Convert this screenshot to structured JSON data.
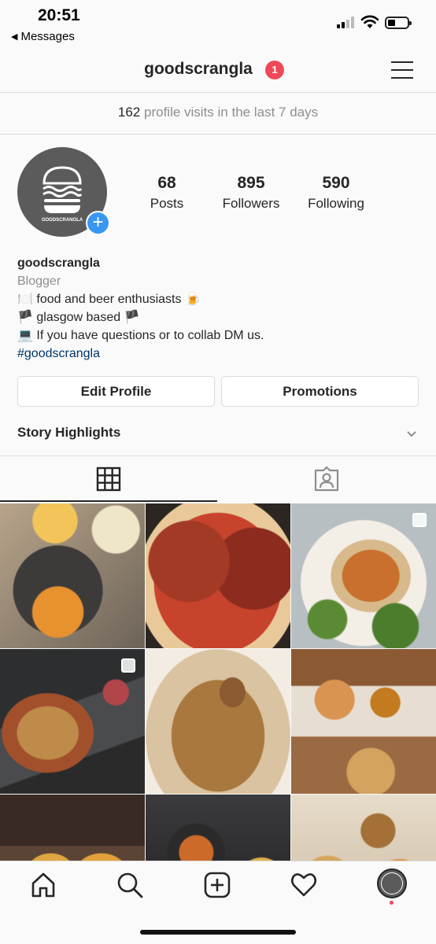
{
  "status_bar": {
    "time": "20:51",
    "back_label": "Messages"
  },
  "header": {
    "username": "goodscrangla",
    "notification_count": "1"
  },
  "visits": {
    "count": "162",
    "label": "profile visits in the last 7 days"
  },
  "profile": {
    "avatar_text": "GOODSCRANGLA",
    "stats": [
      {
        "value": "68",
        "label": "Posts"
      },
      {
        "value": "895",
        "label": "Followers"
      },
      {
        "value": "590",
        "label": "Following"
      }
    ]
  },
  "bio": {
    "name": "goodscrangla",
    "category": "Blogger",
    "lines": [
      "🍽️ food and beer enthusiasts 🍺",
      "🏴 glasgow based 🏴",
      "💻 If you have questions or to collab DM us."
    ],
    "hashtag": "#goodscrangla"
  },
  "buttons": {
    "edit_profile": "Edit Profile",
    "promotions": "Promotions"
  },
  "highlights": {
    "label": "Story Highlights"
  },
  "tabs": {
    "active": "grid"
  },
  "colors": {
    "accent_blue": "#3897f0",
    "badge_red": "#ed4956",
    "hashtag_blue": "#003569",
    "secondary_text": "#8e8e8e",
    "border": "#dbdbdb",
    "avatar_gray": "#5b5b5b"
  },
  "grid_photos": [
    {
      "subject": "kebab plate with fries",
      "multi": false
    },
    {
      "subject": "pizza",
      "multi": false
    },
    {
      "subject": "stacked dish with sauce",
      "multi": true
    },
    {
      "subject": "dessert in clay dish",
      "multi": true
    },
    {
      "subject": "biscoff dessert",
      "multi": false
    },
    {
      "subject": "takeaway tray spread",
      "multi": false
    },
    {
      "subject": "corona beers",
      "multi": false
    },
    {
      "subject": "bar snacks",
      "multi": false
    },
    {
      "subject": "baked pastries",
      "multi": false
    }
  ],
  "bottom_nav": [
    "home-icon",
    "search-icon",
    "add-post-icon",
    "activity-heart-icon",
    "profile-avatar"
  ]
}
